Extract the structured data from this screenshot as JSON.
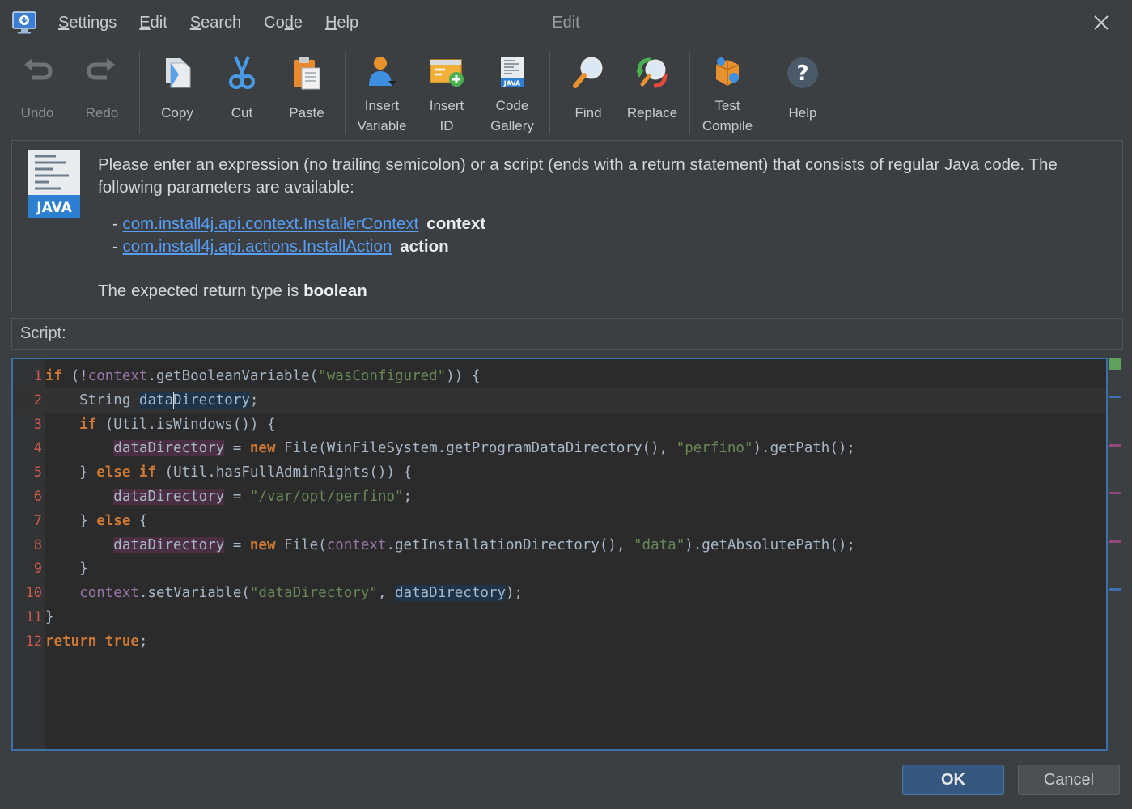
{
  "menu": {
    "items": [
      {
        "label": "Settings",
        "mnemonic": "S",
        "rest": "ettings"
      },
      {
        "label": "Edit",
        "mnemonic": "E",
        "rest": "dit"
      },
      {
        "label": "Search",
        "mnemonic": "S",
        "rest": "earch"
      },
      {
        "label": "Code",
        "pre": "Co",
        "mnemonic": "d",
        "rest": "e"
      },
      {
        "label": "Help",
        "mnemonic": "H",
        "rest": "elp"
      }
    ],
    "window_title": "Edit"
  },
  "toolbar": {
    "undo": "Undo",
    "redo": "Redo",
    "copy": "Copy",
    "cut": "Cut",
    "paste": "Paste",
    "insert_variable_1": "Insert",
    "insert_variable_2": "Variable",
    "insert_id_1": "Insert",
    "insert_id_2": "ID",
    "code_gallery_1": "Code",
    "code_gallery_2": "Gallery",
    "find": "Find",
    "replace": "Replace",
    "test_compile_1": "Test",
    "test_compile_2": "Compile",
    "help": "Help"
  },
  "info": {
    "java_badge": "JAVA",
    "description": "Please enter an expression (no trailing semicolon) or a script (ends with a return statement) that consists of regular Java code. The following parameters are available:",
    "params": [
      {
        "type": "com.install4j.api.context.InstallerContext",
        "name": "context"
      },
      {
        "type": "com.install4j.api.actions.InstallAction",
        "name": "action"
      }
    ],
    "return_prefix": "The expected return type is",
    "return_type": "boolean"
  },
  "script_label": "Script:",
  "editor": {
    "lines": [
      "if (!context.getBooleanVariable(\"wasConfigured\")) {",
      "    String dataDirectory;",
      "    if (Util.isWindows()) {",
      "        dataDirectory = new File(WinFileSystem.getProgramDataDirectory(), \"perfino\").getPath();",
      "    } else if (Util.hasFullAdminRights()) {",
      "        dataDirectory = \"/var/opt/perfino\";",
      "    } else {",
      "        dataDirectory = new File(context.getInstallationDirectory(), \"data\").getAbsolutePath();",
      "    }",
      "    context.setVariable(\"dataDirectory\", dataDirectory);",
      "}",
      "return true;"
    ],
    "line_numbers": [
      "1",
      "2",
      "3",
      "4",
      "5",
      "6",
      "7",
      "8",
      "9",
      "10",
      "11",
      "12"
    ],
    "current_line": 2
  },
  "buttons": {
    "ok": "OK",
    "cancel": "Cancel"
  },
  "colors": {
    "keyword": "#cc7832",
    "context": "#9876aa",
    "string": "#6a8759",
    "link": "#589df6",
    "editor_border": "#3d6faa"
  }
}
